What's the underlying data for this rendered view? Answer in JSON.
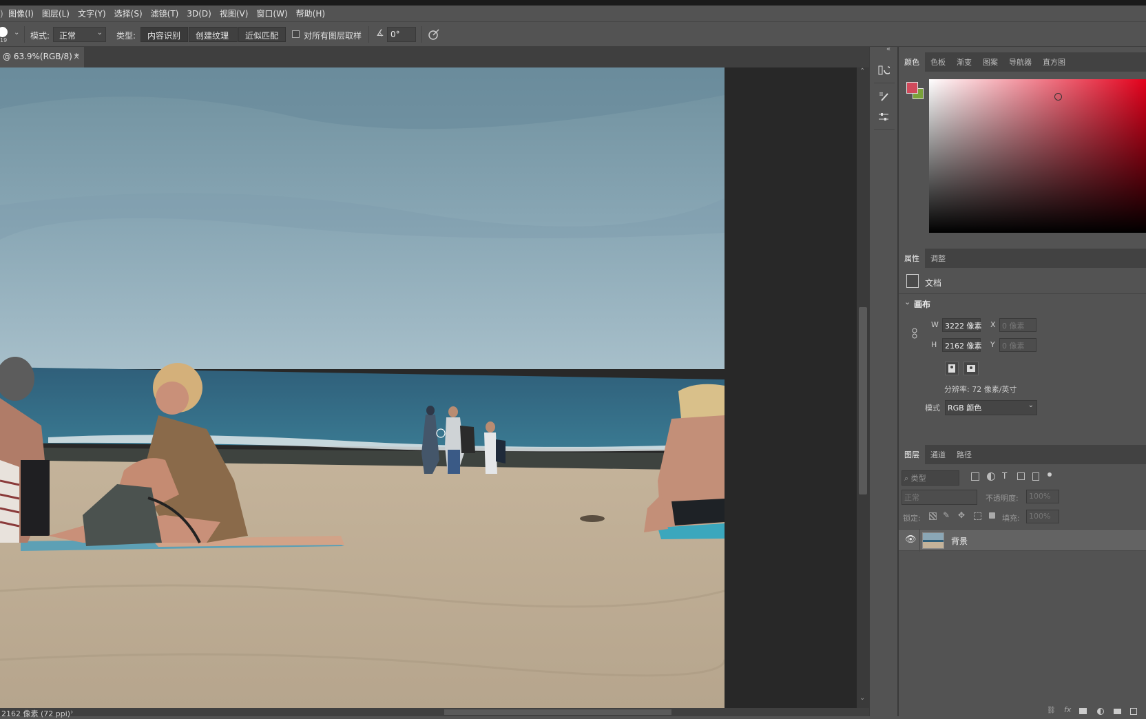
{
  "menu": {
    "items": [
      "图像(I)",
      "图层(L)",
      "文字(Y)",
      "选择(S)",
      "滤镜(T)",
      "3D(D)",
      "视图(V)",
      "窗口(W)",
      "帮助(H)"
    ]
  },
  "options": {
    "brush_size": "19",
    "mode_label": "模式:",
    "mode_value": "正常",
    "type_label": "类型:",
    "type_buttons": [
      "内容识别",
      "创建纹理",
      "近似匹配"
    ],
    "sample_all_label": "对所有图层取样",
    "angle_value": "0°"
  },
  "document": {
    "tab_title": "@ 63.9%(RGB/8) *",
    "close_symbol": "×",
    "status_text": "2162 像素 (72 ppi)"
  },
  "color_panel": {
    "tabs": [
      "颜色",
      "色板",
      "渐变",
      "图案",
      "导航器",
      "直方图"
    ],
    "foreground_color": "#d04a5c",
    "background_color": "#7aa23a",
    "hue_color": "#e3001b"
  },
  "properties_panel": {
    "tabs": [
      "属性",
      "调整"
    ],
    "doc_label": "文档",
    "canvas_section": "画布",
    "w_label": "W",
    "w_value": "3222 像素",
    "h_label": "H",
    "h_value": "2162 像素",
    "x_label": "X",
    "x_placeholder": "0 像素",
    "y_label": "Y",
    "y_placeholder": "0 像素",
    "resolution": "分辨率: 72 像素/英寸",
    "mode_label": "模式",
    "mode_value": "RGB 颜色"
  },
  "layers_panel": {
    "tabs": [
      "图层",
      "通道",
      "路径"
    ],
    "filter_placeholder": "类型",
    "blend_mode": "正常",
    "opacity_label": "不透明度:",
    "opacity_value": "100%",
    "lock_label": "锁定:",
    "fill_label": "填充:",
    "fill_value": "100%",
    "layers": [
      {
        "name": "背景",
        "visible": true
      }
    ]
  }
}
